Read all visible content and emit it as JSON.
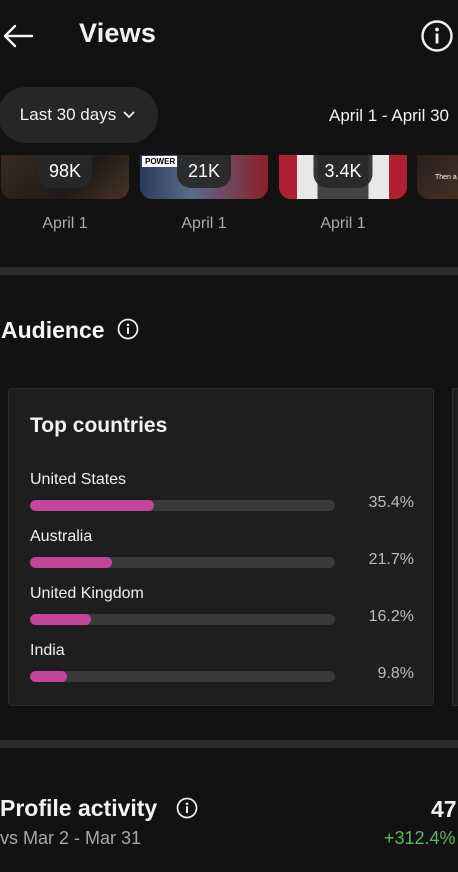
{
  "header": {
    "title": "Views"
  },
  "filter": {
    "range_label": "Last 30 days",
    "date_range": "April 1 - April 30"
  },
  "top_content": [
    {
      "views": "98K",
      "date": "April 1",
      "overlay": ""
    },
    {
      "views": "21K",
      "date": "April 1",
      "overlay": "POWER"
    },
    {
      "views": "3.4K",
      "date": "April 1",
      "overlay": ""
    },
    {
      "views": "",
      "date": "",
      "overlay": "Then a"
    }
  ],
  "audience": {
    "title": "Audience",
    "card_title": "Top countries",
    "countries": [
      {
        "name": "United States",
        "pct_label": "35.4%",
        "fraction": 0.405
      },
      {
        "name": "Australia",
        "pct_label": "21.7%",
        "fraction": 0.27
      },
      {
        "name": "United Kingdom",
        "pct_label": "16.2%",
        "fraction": 0.2
      },
      {
        "name": "India",
        "pct_label": "9.8%",
        "fraction": 0.12
      }
    ]
  },
  "profile_activity": {
    "title": "Profile activity",
    "comparison": "vs Mar 2 - Mar 31",
    "value": "47",
    "change": "+312.4%"
  },
  "colors": {
    "accent_bar": "#c2459a",
    "positive": "#5cb85c",
    "background": "#121212"
  }
}
